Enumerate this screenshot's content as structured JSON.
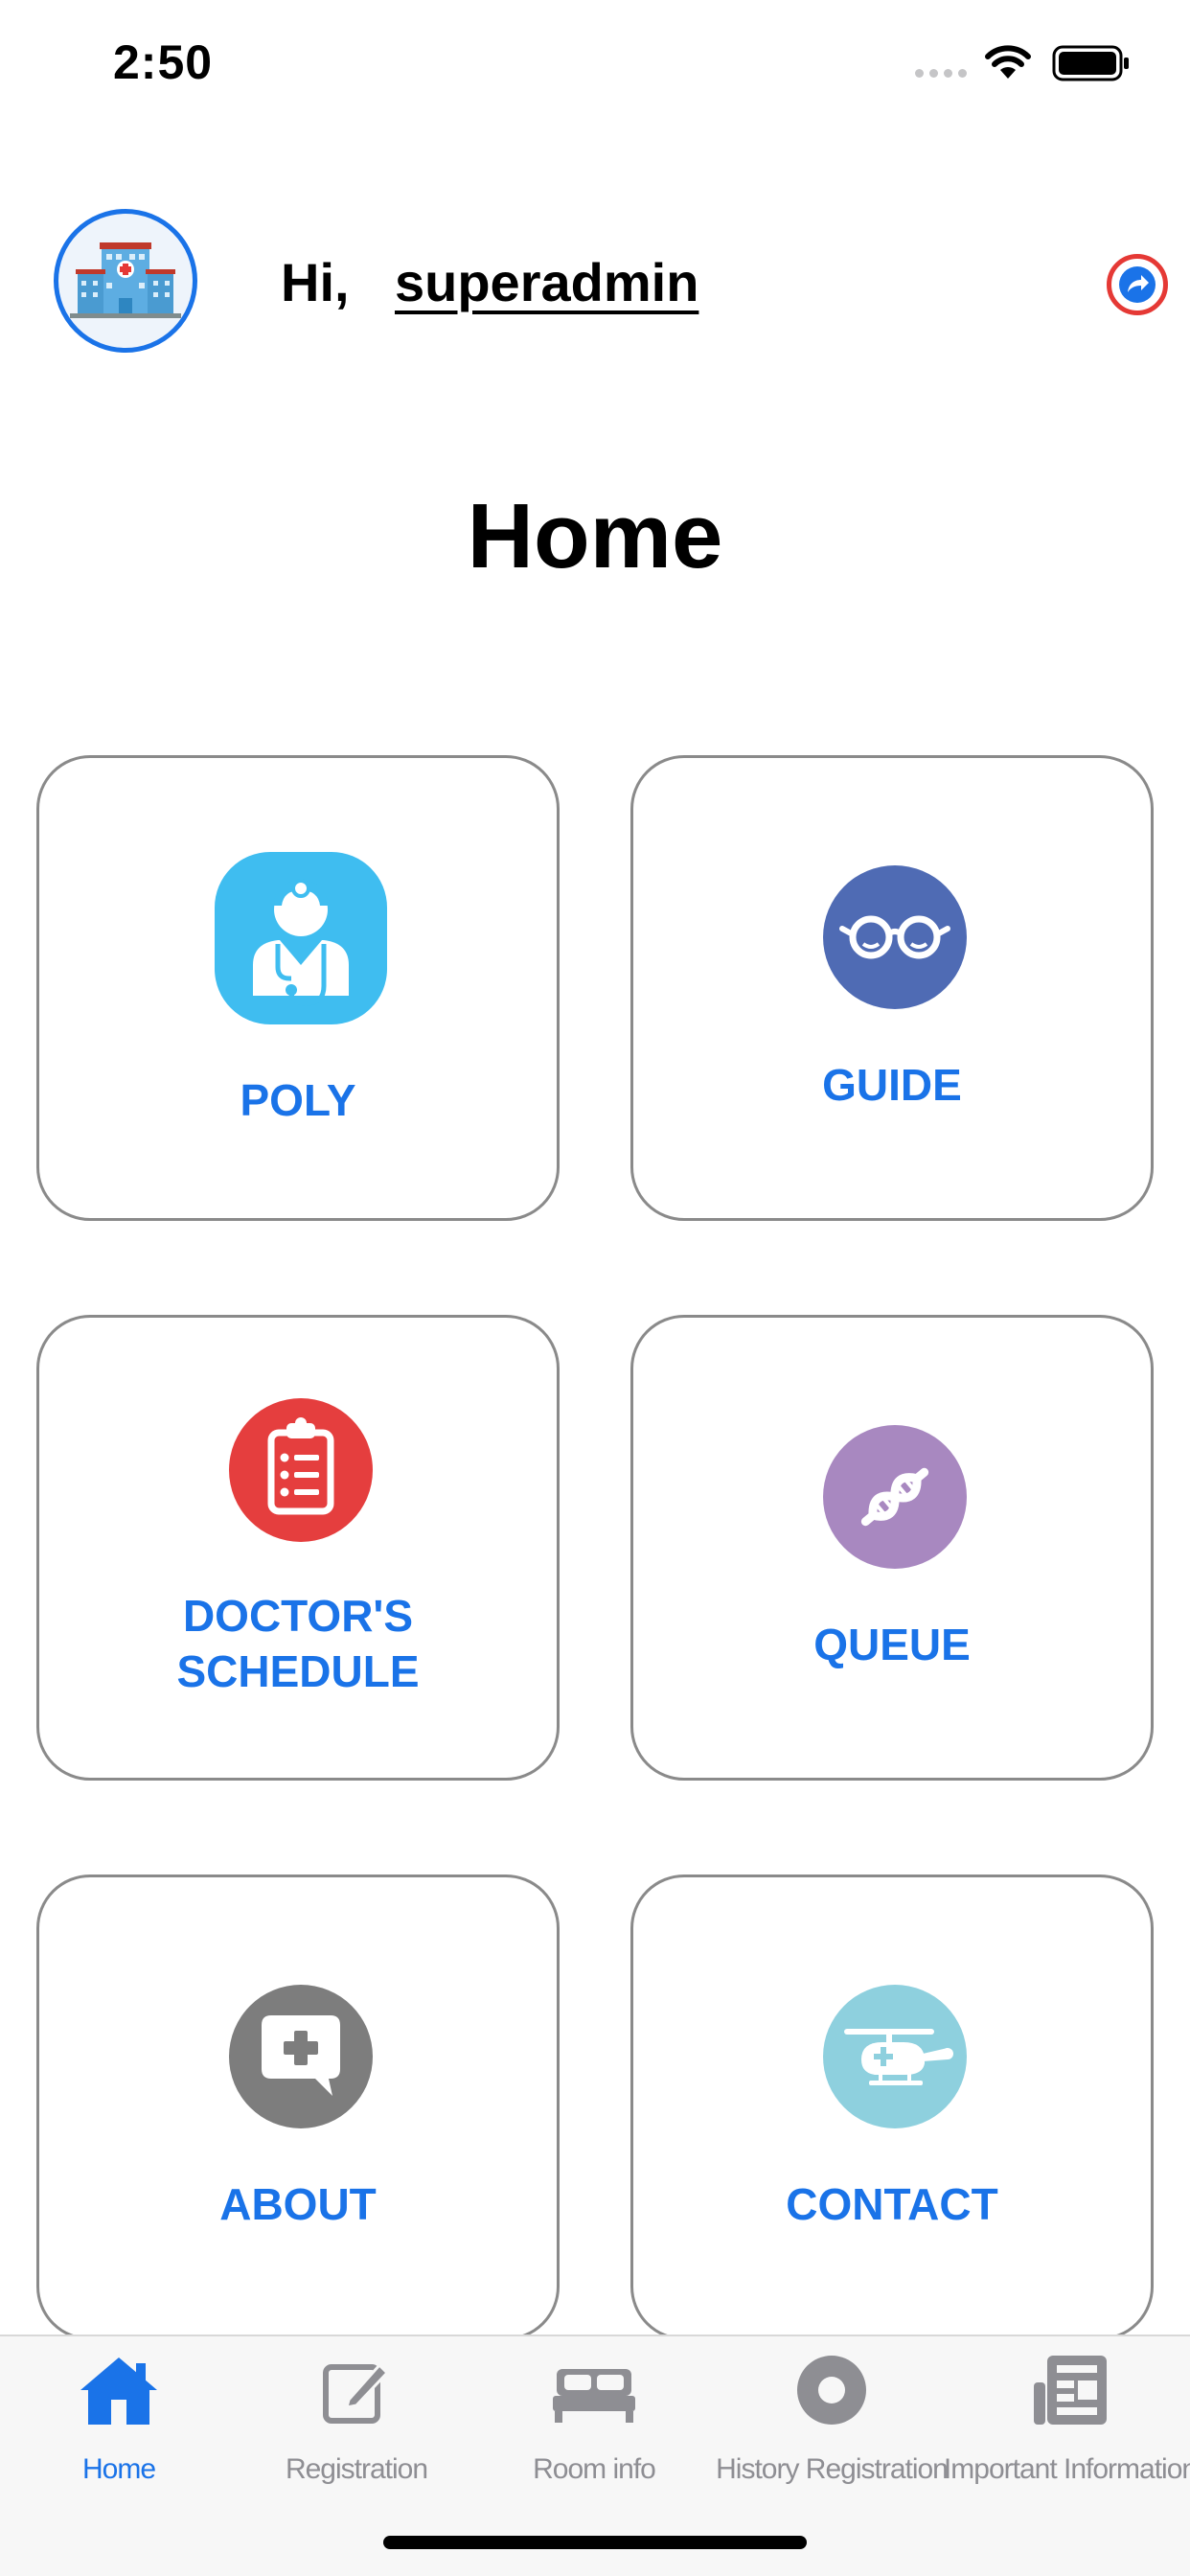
{
  "status_bar": {
    "time": "2:50"
  },
  "header": {
    "greeting": "Hi,",
    "username": "superadmin",
    "title": "Home"
  },
  "menu": {
    "poly": "POLY",
    "guide": "GUIDE",
    "doctor_schedule_line1": "DOCTOR'S",
    "doctor_schedule_line2": "SCHEDULE",
    "queue": "QUEUE",
    "about": "ABOUT",
    "contact": "CONTACT"
  },
  "tabs": {
    "home": "Home",
    "registration": "Registration",
    "room_info": "Room info",
    "history_registration": "History Registration",
    "important_information": "Important Information"
  },
  "colors": {
    "accent": "#1a73e8",
    "poly_icon": "#3fbdf0",
    "guide_icon": "#4f6bb4",
    "schedule_icon": "#e53e3e",
    "queue_icon": "#a888c0",
    "about_icon": "#7d7d7d",
    "contact_icon": "#8ed0de"
  },
  "icons": {
    "avatar": "hospital-building-icon",
    "logout": "share-arrow-icon",
    "poly": "doctor-icon",
    "guide": "glasses-icon",
    "schedule": "clipboard-icon",
    "queue": "dna-icon",
    "about": "chat-plus-icon",
    "contact": "helicopter-icon"
  }
}
